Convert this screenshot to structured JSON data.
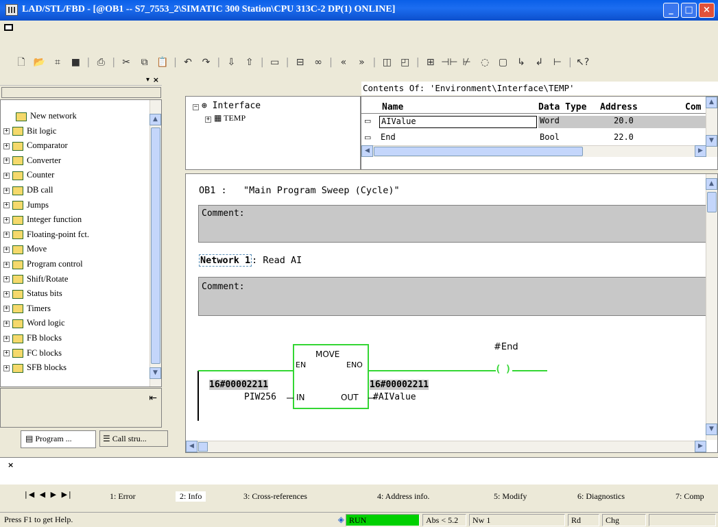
{
  "window": {
    "title": "LAD/STL/FBD  - [@OB1 -- S7_7553_2\\SIMATIC 300 Station\\CPU 313C-2 DP(1)  ONLINE]"
  },
  "catalog": {
    "items": [
      {
        "label": "New network",
        "expander": false
      },
      {
        "label": "Bit logic",
        "expander": true
      },
      {
        "label": "Comparator",
        "expander": true
      },
      {
        "label": "Converter",
        "expander": true
      },
      {
        "label": "Counter",
        "expander": true
      },
      {
        "label": "DB call",
        "expander": true
      },
      {
        "label": "Jumps",
        "expander": true
      },
      {
        "label": "Integer function",
        "expander": true
      },
      {
        "label": "Floating-point fct.",
        "expander": true
      },
      {
        "label": "Move",
        "expander": true
      },
      {
        "label": "Program control",
        "expander": true
      },
      {
        "label": "Shift/Rotate",
        "expander": true
      },
      {
        "label": "Status bits",
        "expander": true
      },
      {
        "label": "Timers",
        "expander": true
      },
      {
        "label": "Word logic",
        "expander": true
      },
      {
        "label": "FB blocks",
        "expander": true
      },
      {
        "label": "FC blocks",
        "expander": true
      },
      {
        "label": "SFB blocks",
        "expander": true
      }
    ],
    "tabs": {
      "program": "Program ...",
      "call": "Call stru..."
    }
  },
  "interface": {
    "contents_of": "Contents Of:  'Environment\\Interface\\TEMP'",
    "tree_root": "Interface",
    "tree_child": "TEMP",
    "columns": {
      "name": "Name",
      "type": "Data Type",
      "address": "Address",
      "comment": "Com"
    },
    "rows": [
      {
        "name": "AIValue",
        "type": "Word",
        "address": "20.0"
      },
      {
        "name": "End",
        "type": "Bool",
        "address": "22.0"
      }
    ]
  },
  "block": {
    "header": "OB1 :   \"Main Program Sweep (Cycle)\"",
    "comment_label": "Comment:",
    "network_label": "Network 1",
    "network_title": ": Read AI",
    "network_comment": "Comment:"
  },
  "ladder": {
    "box_name": "MOVE",
    "en": "EN",
    "eno": "ENO",
    "in_pin": "IN",
    "out_pin": "OUT",
    "in_value": "16#00002211",
    "in_operand": "PIW256",
    "out_value": "16#00002211",
    "out_operand": "#AIValue",
    "coil_operand": "#End",
    "coil_symbol": "( )"
  },
  "tabs": [
    "1: Error",
    "2: Info",
    "3: Cross-references",
    "4: Address info.",
    "5: Modify",
    "6: Diagnostics",
    "7: Comp"
  ],
  "status": {
    "help": "Press F1 to get Help.",
    "mode": "RUN",
    "abs": "Abs < 5.2",
    "nw": "Nw 1",
    "rd": "Rd",
    "chg": "Chg"
  },
  "colors": {
    "status_ok": "#00d000",
    "signal": "#33d633",
    "title_bar": "#0a5fe8"
  }
}
